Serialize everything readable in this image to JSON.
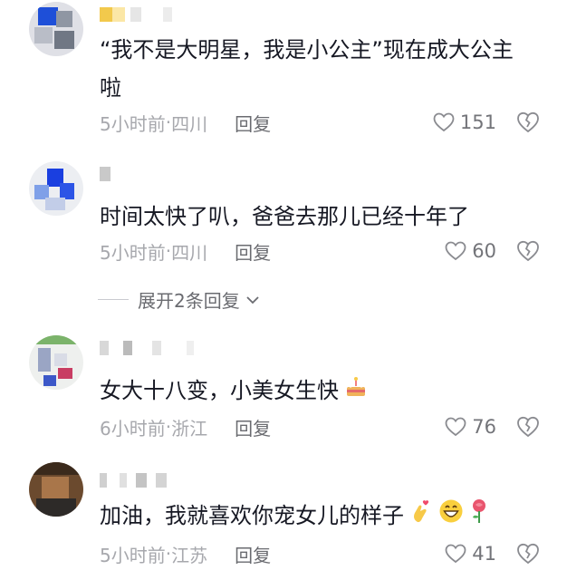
{
  "comments": [
    {
      "text": "“我不是大明星，我是小公主”现在成大公主啦",
      "time": "5小时前",
      "location": "四川",
      "reply_label": "回复",
      "likes": "151"
    },
    {
      "text": "时间太快了叭，爸爸去那儿已经十年了",
      "time": "5小时前",
      "location": "四川",
      "reply_label": "回复",
      "likes": "60",
      "expand_label": "展开2条回复"
    },
    {
      "text": "女大十八变，小美女生快",
      "time": "6小时前",
      "location": "浙江",
      "reply_label": "回复",
      "likes": "76",
      "emojis": [
        "cake-emoji"
      ]
    },
    {
      "text": "加油，我就喜欢你宠女儿的样子",
      "time": "5小时前",
      "location": "江苏",
      "reply_label": "回复",
      "likes": "41",
      "emojis": [
        "finger-heart-emoji",
        "grinning-face-emoji",
        "rose-emoji"
      ]
    }
  ],
  "separator": " · ",
  "icons": [
    "heart-outline-icon",
    "broken-heart-icon",
    "chevron-down-icon"
  ],
  "colors": {
    "text": "#161823",
    "meta": "#a7a8ad",
    "reply": "#6a6b70"
  }
}
